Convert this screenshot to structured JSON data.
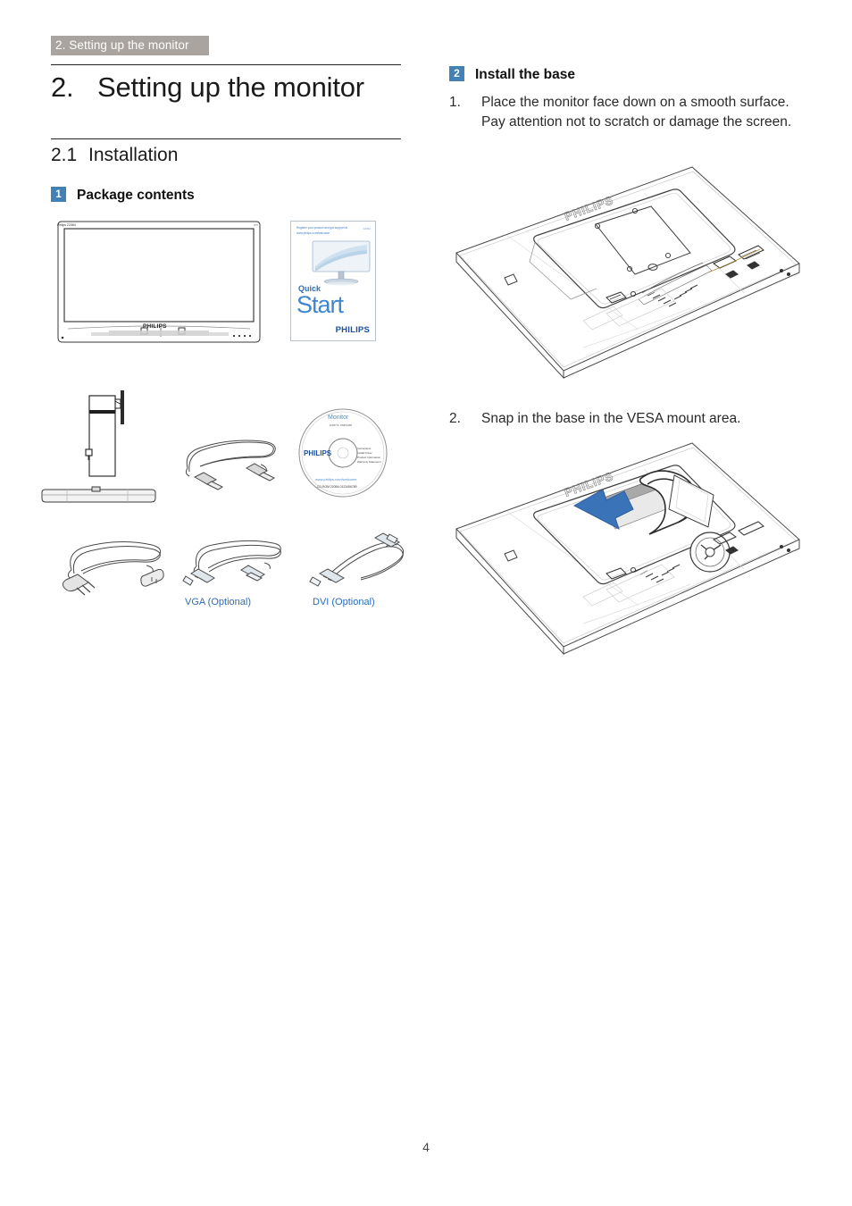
{
  "document": {
    "running_header": "2. Setting up the monitor",
    "page_number": "4"
  },
  "chapter": {
    "number": "2.",
    "title": "Setting up the monitor"
  },
  "section": {
    "number": "2.1",
    "title": "Installation"
  },
  "left_column": {
    "subsection": {
      "badge": "1",
      "label": "Package contents"
    },
    "captions": {
      "vga": "VGA (Optional)",
      "dvi": "DVI (Optional)"
    },
    "booklet": {
      "top_line_1": "Register your product and get support at",
      "top_line_2": "www.philips.com/welcome",
      "code": "220B4",
      "quick": "Quick",
      "start": "Start",
      "brand": "PHILIPS"
    },
    "cd": {
      "title": "Monitor",
      "subtitle": "user's manual",
      "brand": "PHILIPS",
      "url": "www.philips.com/welcome",
      "side_lines": "Instructions\nInstall Driver\nProduct Information\nWarranty Statement",
      "barcode": "CD-ROM 220B4 0123456789"
    },
    "monitor": {
      "brand": "PHILIPS"
    }
  },
  "right_column": {
    "subsection": {
      "badge": "2",
      "label": "Install the base"
    },
    "steps": [
      {
        "number": "1.",
        "text": "Place the monitor face down on a smooth surface. Pay attention not to scratch or damage the screen."
      },
      {
        "number": "2.",
        "text": "Snap in the base in the VESA mount area."
      }
    ],
    "figure_1": {
      "brand": "PHILIPS"
    },
    "figure_2": {
      "brand": "PHILIPS"
    }
  },
  "colors": {
    "header_bar": "#a9a49f",
    "badge_blue": "#4380b4",
    "caption_blue": "#2a6ebb",
    "arrow_blue": "#3b73b9",
    "rule": "#222222",
    "line_art": "#3a3a3a"
  }
}
